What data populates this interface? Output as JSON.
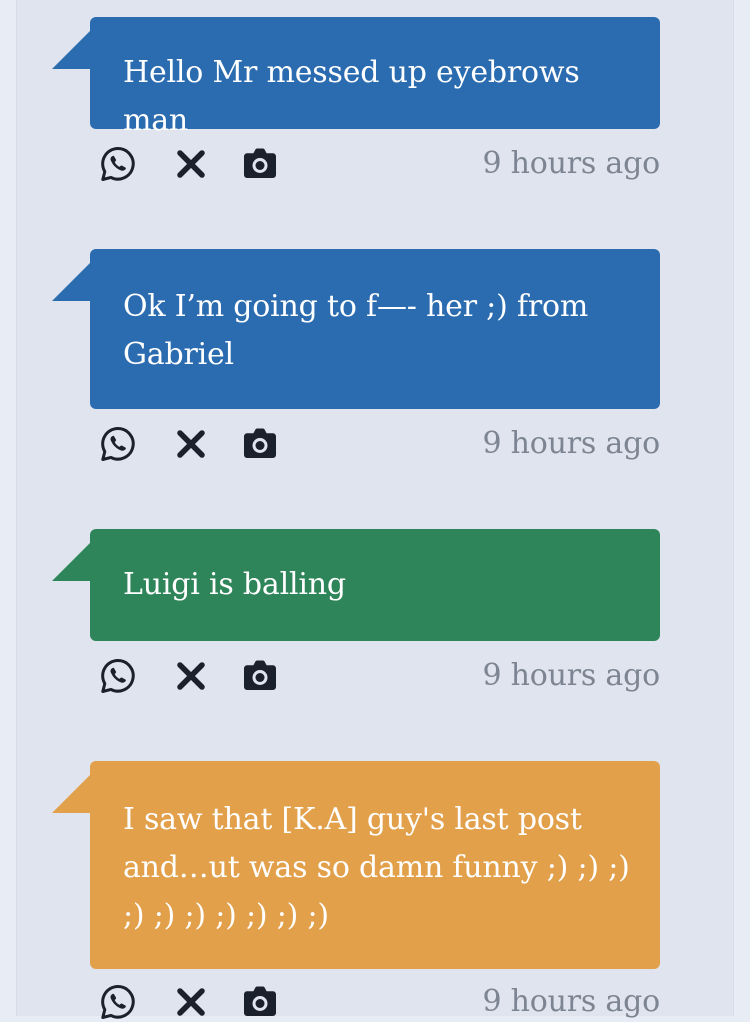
{
  "colors": {
    "blue": "#2b6cb0",
    "green": "#2f855a",
    "orange": "#e2a04b",
    "icon": "#1a202c",
    "timestamp": "#7d8592"
  },
  "posts": [
    {
      "text": "Hello Mr messed up eyebrows man",
      "color": "blue",
      "time": "9 hours ago",
      "icons": [
        "whatsapp-icon",
        "close-icon",
        "camera-icon"
      ]
    },
    {
      "text": "Ok I’m going to f—- her ;) from Gabriel",
      "color": "blue",
      "time": "9 hours ago",
      "icons": [
        "whatsapp-icon",
        "close-icon",
        "camera-icon"
      ]
    },
    {
      "text": "Luigi is balling",
      "color": "green",
      "time": "9 hours ago",
      "icons": [
        "whatsapp-icon",
        "close-icon",
        "camera-icon"
      ]
    },
    {
      "text": "I saw that [K.A] guy's last post and…ut was so damn funny ;) ;) ;) ;) ;) ;) ;) ;) ;) ;)",
      "color": "orange",
      "time": "9 hours ago",
      "icons": [
        "whatsapp-icon",
        "close-icon",
        "camera-icon"
      ]
    }
  ]
}
